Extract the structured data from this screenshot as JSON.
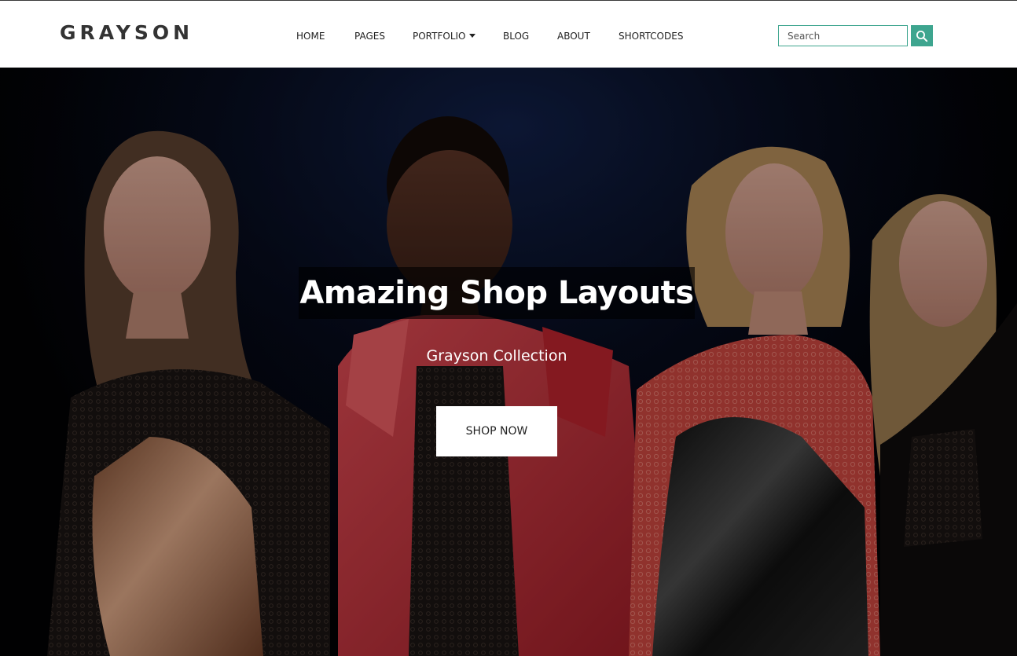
{
  "brand": {
    "logo_text": "GRAYSON"
  },
  "nav": {
    "items": [
      {
        "label": "HOME"
      },
      {
        "label": "PAGES"
      },
      {
        "label": "PORTFOLIO",
        "has_dropdown": true
      },
      {
        "label": "BLOG"
      },
      {
        "label": "ABOUT"
      },
      {
        "label": "SHORTCODES"
      }
    ]
  },
  "search": {
    "placeholder": "Search",
    "value": "",
    "icon": "search-icon"
  },
  "hero": {
    "title": "Amazing Shop Layouts",
    "subtitle": "Grayson Collection",
    "cta_label": "SHOP NOW",
    "image": "fashion-models-photo"
  },
  "colors": {
    "accent": "#3ea58f",
    "logo": "#333333",
    "nav_text": "#222222",
    "hero_background": "#020204"
  }
}
